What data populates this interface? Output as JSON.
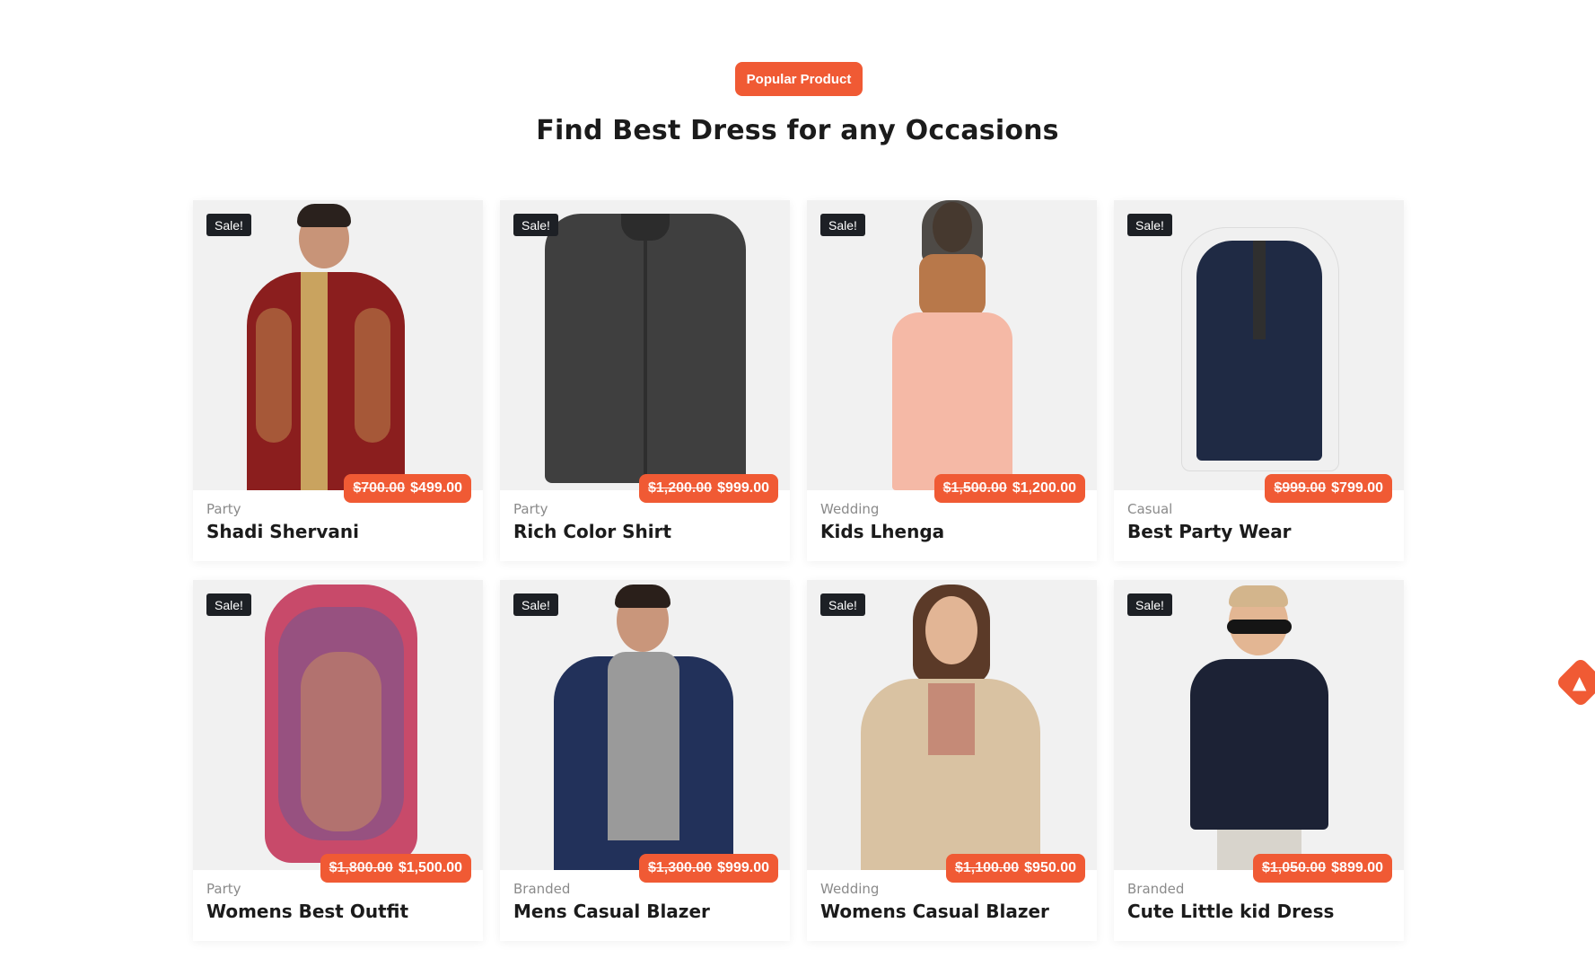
{
  "section": {
    "tag": "Popular Product",
    "title": "Find Best Dress for any Occasions"
  },
  "accent_color": "#f05a34",
  "sale_badge_color": "#1d2025",
  "products": [
    {
      "sale": "Sale!",
      "old_price": "$700.00",
      "price": "$499.00",
      "category": "Party",
      "name": "Shadi Shervani"
    },
    {
      "sale": "Sale!",
      "old_price": "$1,200.00",
      "price": "$999.00",
      "category": "Party",
      "name": "Rich Color Shirt"
    },
    {
      "sale": "Sale!",
      "old_price": "$1,500.00",
      "price": "$1,200.00",
      "category": "Wedding",
      "name": "Kids Lhenga"
    },
    {
      "sale": "Sale!",
      "old_price": "$999.00",
      "price": "$799.00",
      "category": "Casual",
      "name": "Best Party Wear"
    },
    {
      "sale": "Sale!",
      "old_price": "$1,800.00",
      "price": "$1,500.00",
      "category": "Party",
      "name": "Womens Best Outfit"
    },
    {
      "sale": "Sale!",
      "old_price": "$1,300.00",
      "price": "$999.00",
      "category": "Branded",
      "name": "Mens Casual Blazer"
    },
    {
      "sale": "Sale!",
      "old_price": "$1,100.00",
      "price": "$950.00",
      "category": "Wedding",
      "name": "Womens Casual Blazer"
    },
    {
      "sale": "Sale!",
      "old_price": "$1,050.00",
      "price": "$899.00",
      "category": "Branded",
      "name": "Cute Little kid Dress"
    }
  ],
  "floating_button": {
    "icon": "rocket-icon"
  }
}
